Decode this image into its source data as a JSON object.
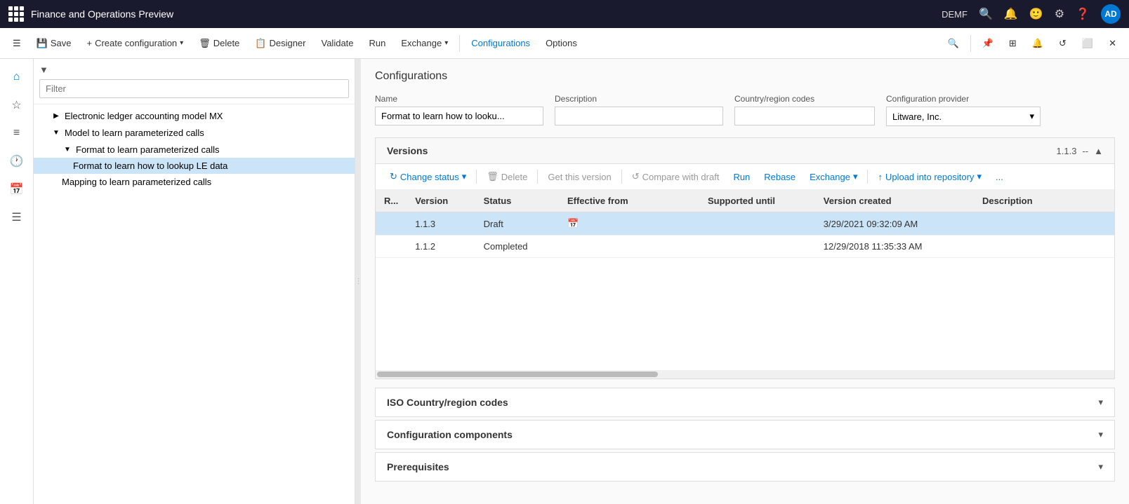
{
  "titlebar": {
    "title": "Finance and Operations Preview",
    "user": "DEMF",
    "avatar": "AD"
  },
  "toolbar": {
    "save_label": "Save",
    "create_config_label": "Create configuration",
    "delete_label": "Delete",
    "designer_label": "Designer",
    "validate_label": "Validate",
    "run_label": "Run",
    "exchange_label": "Exchange",
    "configurations_label": "Configurations",
    "options_label": "Options"
  },
  "tree": {
    "filter_placeholder": "Filter",
    "items": [
      {
        "id": "item1",
        "label": "Electronic ledger accounting model MX",
        "indent": 1,
        "expanded": false,
        "toggle": "▶"
      },
      {
        "id": "item2",
        "label": "Model to learn parameterized calls",
        "indent": 1,
        "expanded": true,
        "toggle": "▼"
      },
      {
        "id": "item3",
        "label": "Format to learn parameterized calls",
        "indent": 2,
        "expanded": true,
        "toggle": "▼"
      },
      {
        "id": "item4",
        "label": "Format to learn how to lookup LE data",
        "indent": 3,
        "selected": true
      },
      {
        "id": "item5",
        "label": "Mapping to learn parameterized calls",
        "indent": 2
      }
    ]
  },
  "configurations": {
    "section_title": "Configurations",
    "fields": {
      "name_label": "Name",
      "name_value": "Format to learn how to looku...",
      "description_label": "Description",
      "description_value": "",
      "country_label": "Country/region codes",
      "country_value": "",
      "provider_label": "Configuration provider",
      "provider_value": "Litware, Inc."
    },
    "versions": {
      "title": "Versions",
      "version_display": "1.1.3",
      "separator": "--",
      "toolbar": {
        "change_status": "Change status",
        "delete": "Delete",
        "get_this_version": "Get this version",
        "compare_with_draft": "Compare with draft",
        "run": "Run",
        "rebase": "Rebase",
        "exchange": "Exchange",
        "upload_into_repository": "Upload into repository",
        "more": "..."
      },
      "table": {
        "columns": [
          "R...",
          "Version",
          "Status",
          "Effective from",
          "Supported until",
          "Version created",
          "Description"
        ],
        "rows": [
          {
            "r": "",
            "version": "1.1.3",
            "status": "Draft",
            "effective_from": "",
            "supported_until": "",
            "version_created": "3/29/2021 09:32:09 AM",
            "description": "",
            "selected": true
          },
          {
            "r": "",
            "version": "1.1.2",
            "status": "Completed",
            "effective_from": "",
            "supported_until": "",
            "version_created": "12/29/2018 11:35:33 AM",
            "description": "",
            "selected": false
          }
        ]
      }
    },
    "iso_section": "ISO Country/region codes",
    "config_components_section": "Configuration components",
    "prerequisites_section": "Prerequisites"
  }
}
